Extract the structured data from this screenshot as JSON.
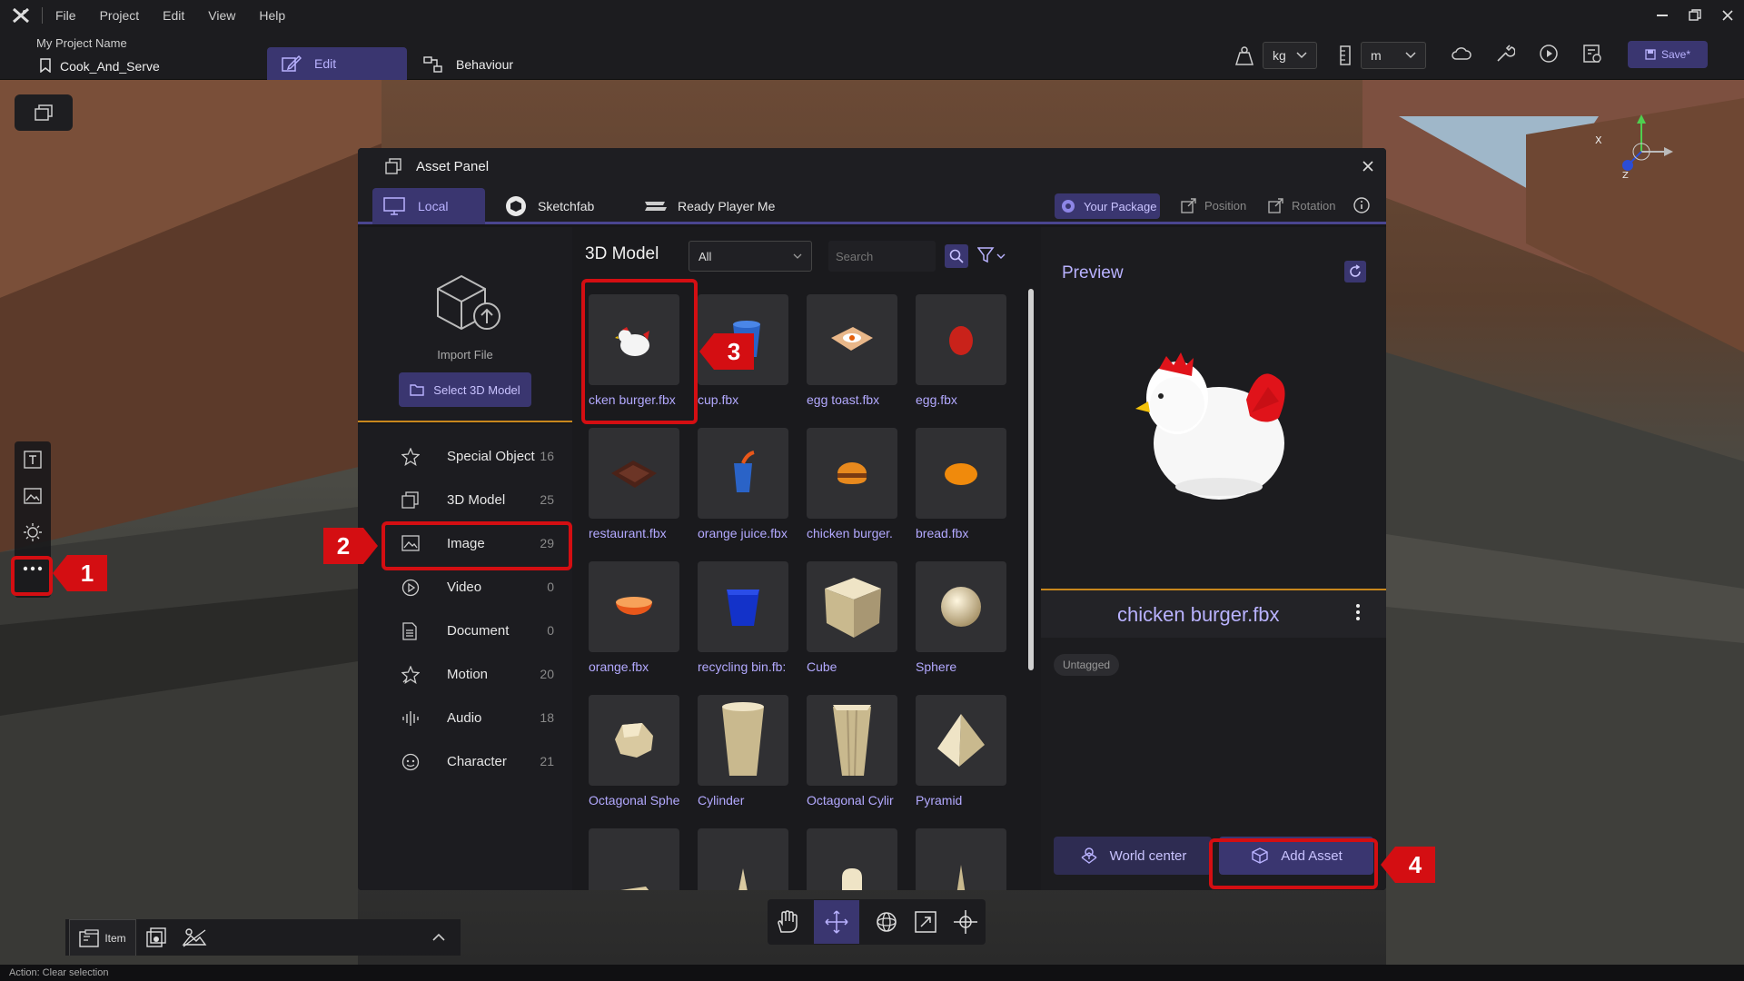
{
  "menu": [
    "File",
    "Project",
    "Edit",
    "View",
    "Help"
  ],
  "header": {
    "project_label": "My Project Name",
    "project_name": "Cook_And_Serve",
    "tab_edit": "Edit",
    "tab_behaviour": "Behaviour",
    "unit_mass": "kg",
    "unit_length": "m",
    "save_label": "Save*"
  },
  "panel": {
    "title": "Asset Panel",
    "tabs": {
      "local": "Local",
      "sketchfab": "Sketchfab",
      "rpm": "Ready Player Me"
    },
    "your_package": "Your Package",
    "position": "Position",
    "rotation": "Rotation",
    "import_file": "Import File",
    "select_model": "Select 3D Model",
    "grid_title": "3D Model",
    "filter_value": "All",
    "search_placeholder": "Search",
    "categories": [
      {
        "label": "Special Object",
        "count": "16"
      },
      {
        "label": "3D Model",
        "count": "25"
      },
      {
        "label": "Image",
        "count": "29"
      },
      {
        "label": "Video",
        "count": "0"
      },
      {
        "label": "Document",
        "count": "0"
      },
      {
        "label": "Motion",
        "count": "20"
      },
      {
        "label": "Audio",
        "count": "18"
      },
      {
        "label": "Character",
        "count": "21"
      }
    ],
    "assets": [
      "cken burger.fbx",
      "cup.fbx",
      "egg toast.fbx",
      "egg.fbx",
      "restaurant.fbx",
      "orange juice.fbx",
      "chicken burger.",
      "bread.fbx",
      "orange.fbx",
      "recycling bin.fb:",
      "Cube",
      "Sphere",
      "Octagonal Sphe",
      "Cylinder",
      "Octagonal Cylir",
      "Pyramid"
    ],
    "preview_title": "Preview",
    "preview_name": "chicken burger.fbx",
    "tag": "Untagged",
    "world_center": "World center",
    "add_asset": "Add Asset"
  },
  "annotations": [
    "1",
    "2",
    "3",
    "4"
  ],
  "bottom": {
    "item_tab": "Item"
  },
  "status": "Action: Clear selection",
  "colors": {
    "accent": "#3a3670",
    "accent_text": "#b9b2ff",
    "annotation_red": "#d40e12",
    "orange_divider": "#c8871d"
  }
}
